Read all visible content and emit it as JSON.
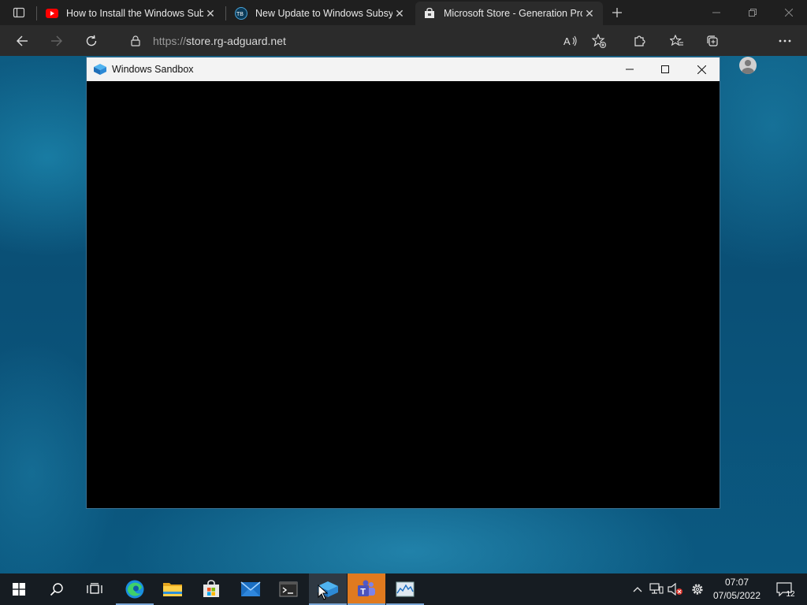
{
  "browser": {
    "tabs": [
      {
        "title": "How to Install the Windows Subsystem for Android",
        "favicon": "youtube-icon",
        "active": false
      },
      {
        "title": "New Update to Windows Subsystem for Android",
        "favicon": "site-icon",
        "active": false
      },
      {
        "title": "Microsoft Store - Generation Project",
        "favicon": "store-bag-icon",
        "active": true
      }
    ],
    "address": {
      "protocol": "https://",
      "host": "store.rg-adguard.net"
    }
  },
  "sandbox": {
    "title": "Windows Sandbox"
  },
  "taskbar": {
    "apps": [
      {
        "name": "start",
        "icon": "windows-logo-icon"
      },
      {
        "name": "search",
        "icon": "search-icon"
      },
      {
        "name": "task-view",
        "icon": "task-view-icon"
      },
      {
        "name": "edge",
        "icon": "edge-icon"
      },
      {
        "name": "file-explorer",
        "icon": "folder-icon"
      },
      {
        "name": "microsoft-store",
        "icon": "store-icon"
      },
      {
        "name": "mail",
        "icon": "mail-icon"
      },
      {
        "name": "terminal",
        "icon": "terminal-icon"
      },
      {
        "name": "windows-sandbox",
        "icon": "sandbox-icon"
      },
      {
        "name": "teams",
        "icon": "teams-icon"
      },
      {
        "name": "resource-monitor",
        "icon": "monitor-icon"
      }
    ],
    "clock": {
      "time": "07:07",
      "date": "07/05/2022"
    },
    "notification_count": "12"
  },
  "colors": {
    "desktop": "#0a4f75",
    "browser_chrome": "#2b2b2b",
    "taskbar": "#161c22",
    "teams_accent": "#e07a1f"
  }
}
